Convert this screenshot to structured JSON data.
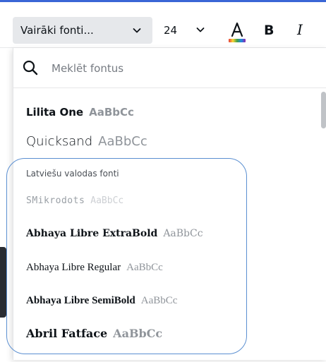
{
  "toolbar": {
    "font_select_label": "Vairāki fonti...",
    "font_size": "24",
    "bold_label": "B",
    "italic_label": "I"
  },
  "colors": {
    "accent": "#3a66d6",
    "select_bg": "#e6e8eb",
    "highlight_outline": "#5b8fd1"
  },
  "search": {
    "placeholder": "Meklēt fontus"
  },
  "fonts_top": [
    {
      "name": "Lilita One",
      "sample": "AaBbCc"
    },
    {
      "name": "Quicksand",
      "sample": "AaBbCc"
    }
  ],
  "section": {
    "label": "Latviešu valodas fonti"
  },
  "fonts_latvian": [
    {
      "name": "SMikrodots",
      "sample": "AaBbCc"
    },
    {
      "name": "Abhaya Libre ExtraBold",
      "sample": "AaBbCc"
    },
    {
      "name": "Abhaya Libre Regular",
      "sample": "AaBbCc"
    },
    {
      "name": "Abhaya Libre SemiBold",
      "sample": "AaBbCc"
    },
    {
      "name": "Abril Fatface",
      "sample": "AaBbCc"
    }
  ]
}
